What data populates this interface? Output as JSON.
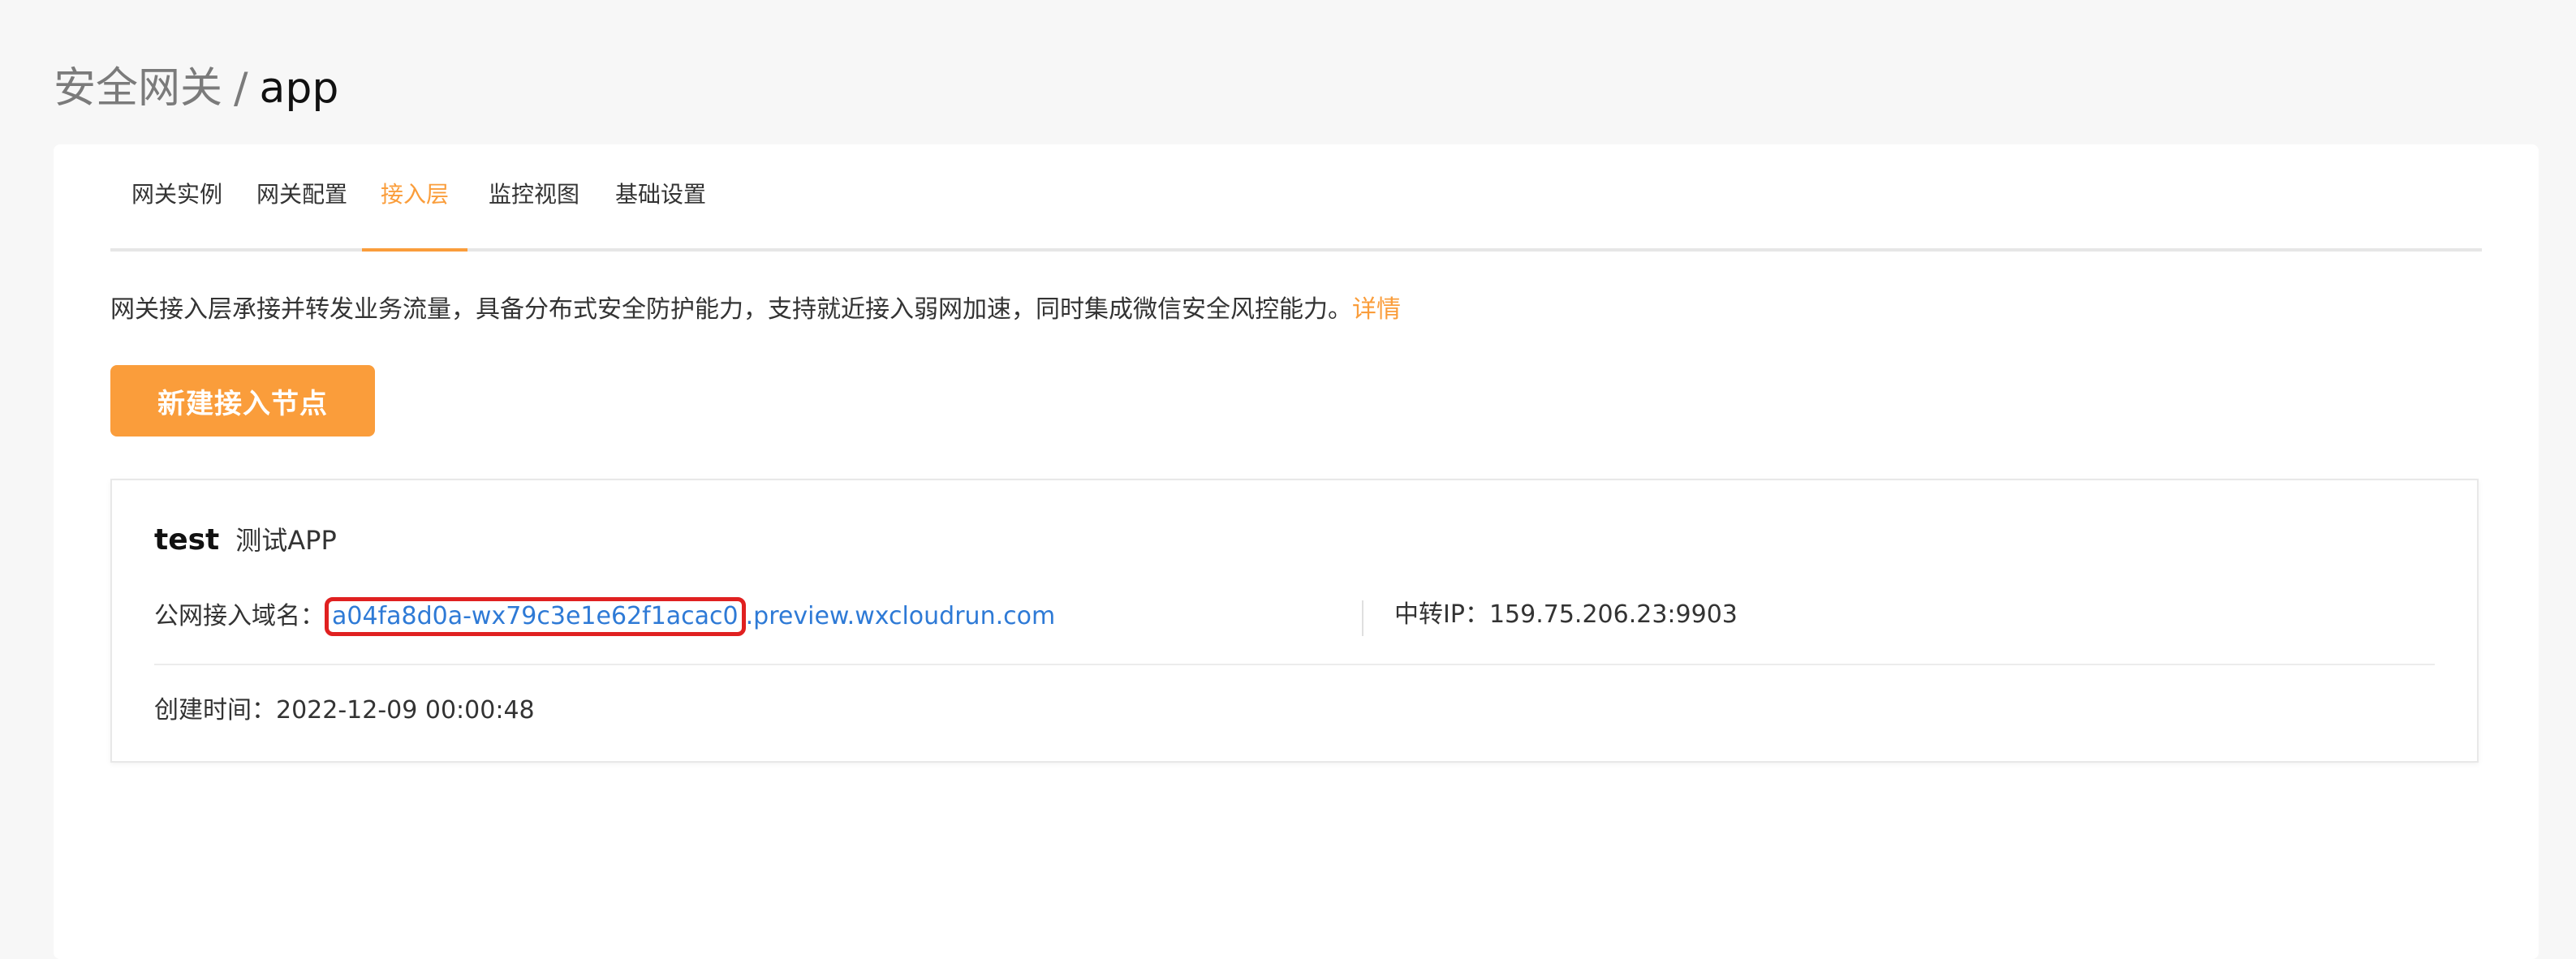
{
  "breadcrumb": {
    "parent": "安全网关",
    "separator": "/",
    "current": "app"
  },
  "tabs": [
    {
      "label": "网关实例",
      "active": false
    },
    {
      "label": "网关配置",
      "active": false
    },
    {
      "label": "接入层",
      "active": true
    },
    {
      "label": "监控视图",
      "active": false
    },
    {
      "label": "基础设置",
      "active": false
    }
  ],
  "description": {
    "text": "网关接入层承接并转发业务流量，具备分布式安全防护能力，支持就近接入弱网加速，同时集成微信安全风控能力。",
    "link": "详情"
  },
  "create_button": {
    "label": "新建接入节点"
  },
  "node": {
    "name": "test",
    "subtitle": "测试APP",
    "domain_label": "公网接入域名：",
    "domain_prefix": "a04fa8d0a-wx79c3e1e62f1acac0",
    "domain_suffix": ".preview.wxcloudrun.com",
    "relay_label": "中转IP：",
    "relay_value": "159.75.206.23:9903",
    "created_label": "创建时间：",
    "created_value": "2022-12-09 00:00:48"
  },
  "colors": {
    "accent": "#fa9d3b",
    "link": "#2e7ad6",
    "highlight": "#e02020"
  }
}
